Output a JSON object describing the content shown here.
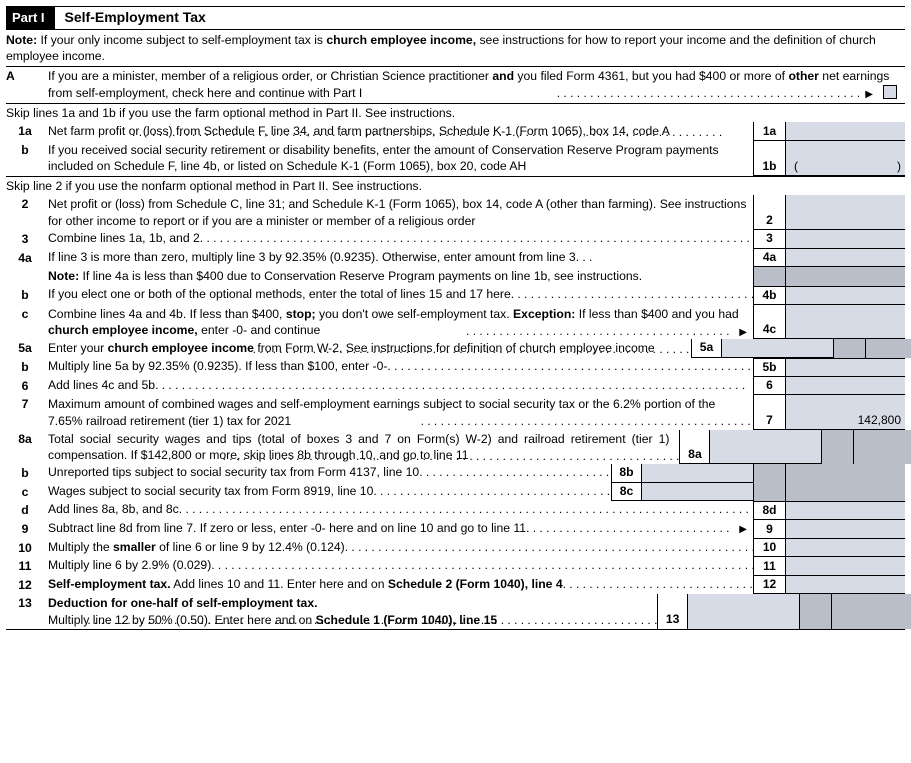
{
  "part": {
    "badge": "Part I",
    "title": "Self-Employment Tax"
  },
  "note": {
    "prefix": "Note:",
    "text1": " If your only income subject to self-employment tax is ",
    "bold1": "church employee income,",
    "text2": " see instructions for how to report your income and the definition of church employee income."
  },
  "A": {
    "label": "A",
    "t1": "If you are a minister, member of a religious order, or Christian Science practitioner ",
    "b1": "and",
    "t2": " you filed Form 4361, but you had $400 or more of ",
    "b2": "other",
    "t3": " net earnings from self-employment, check here and continue with Part I"
  },
  "skip1": "Skip lines 1a and 1b if you use the farm optional method in Part II. See instructions.",
  "l1a": {
    "label": "1a",
    "text": "Net farm profit or (loss) from Schedule F, line 34, and farm partnerships, Schedule K-1 (Form 1065), box 14, code A",
    "num": "1a"
  },
  "l1b": {
    "label": "b",
    "text": "If you received social security retirement or disability benefits, enter the amount of Conservation Reserve Program payments included on Schedule F, line 4b, or listed on Schedule K-1 (Form 1065), box 20, code AH",
    "num": "1b",
    "po": "(",
    "pc": ")"
  },
  "skip2": "Skip line 2 if you use the nonfarm optional method in Part II. See instructions.",
  "l2": {
    "label": "2",
    "text": "Net profit or (loss) from Schedule C, line 31; and Schedule K-1 (Form 1065), box 14, code A (other than farming). See instructions for other income to report or if you are a minister or member of a religious order",
    "num": "2"
  },
  "l3": {
    "label": "3",
    "text": "Combine lines 1a, 1b, and 2",
    "num": "3"
  },
  "l4a": {
    "label": "4a",
    "text": "If line 3 is more than zero, multiply line 3 by 92.35% (0.9235). Otherwise, enter amount from line 3",
    "num": "4a"
  },
  "l4a_note": {
    "b": "Note:",
    "t": " If line 4a is less than $400 due to Conservation Reserve Program payments on line 1b, see instructions."
  },
  "l4b": {
    "label": "b",
    "text": "If you elect one or both of the optional methods, enter the total of lines 15 and 17 here",
    "num": "4b"
  },
  "l4c": {
    "label": "c",
    "t1": "Combine lines 4a and 4b. If less than $400, ",
    "b1": "stop;",
    "t2": " you don't owe self-employment tax. ",
    "b2": "Exception:",
    "t3": " If less than $400 and you had ",
    "b3": "church employee income,",
    "t4": " enter -0- and continue",
    "num": "4c"
  },
  "l5a": {
    "label": "5a",
    "t1": "Enter your ",
    "b1": "church employee income",
    "t2": " from Form W-2. See instructions for definition of church employee income",
    "num": "5a"
  },
  "l5b": {
    "label": "b",
    "text": "Multiply line 5a by 92.35% (0.9235). If less than $100, enter -0-",
    "num": "5b"
  },
  "l6": {
    "label": "6",
    "text": "Add lines 4c and 5b",
    "num": "6"
  },
  "l7": {
    "label": "7",
    "text": "Maximum amount of combined wages and self-employment earnings subject to social security tax or the 6.2% portion of the 7.65% railroad retirement (tier 1) tax for 2021",
    "num": "7",
    "value": "142,800"
  },
  "l8a": {
    "label": "8a",
    "text": "Total social security wages and tips (total of boxes 3 and 7 on Form(s) W-2) and railroad retirement (tier 1) compensation. If $142,800 or more, skip lines 8b through 10, and go to line 11",
    "num": "8a"
  },
  "l8b": {
    "label": "b",
    "text": "Unreported tips subject to social security tax from Form 4137, line 10",
    "num": "8b"
  },
  "l8c": {
    "label": "c",
    "text": "Wages subject to social security tax from Form 8919, line 10",
    "num": "8c"
  },
  "l8d": {
    "label": "d",
    "text": "Add lines 8a, 8b, and 8c",
    "num": "8d"
  },
  "l9": {
    "label": "9",
    "text": "Subtract line 8d from line 7. If zero or less, enter -0- here and on line 10 and go to line 11",
    "num": "9"
  },
  "l10": {
    "label": "10",
    "t1": "Multiply the ",
    "b1": "smaller",
    "t2": " of line 6 or line 9 by 12.4% (0.124)",
    "num": "10"
  },
  "l11": {
    "label": "11",
    "text": "Multiply line 6 by 2.9% (0.029)",
    "num": "11"
  },
  "l12": {
    "label": "12",
    "b1": "Self-employment tax.",
    "t1": " Add lines 10 and 11. Enter here and on ",
    "b2": "Schedule 2 (Form 1040), line 4",
    "num": "12"
  },
  "l13": {
    "label": "13",
    "b1": "Deduction for one-half of self-employment tax.",
    "t1": "Multiply line 12 by 50% (0.50). Enter here and on ",
    "b2": "Schedule 1 (Form 1040), line 15",
    "num": "13"
  }
}
